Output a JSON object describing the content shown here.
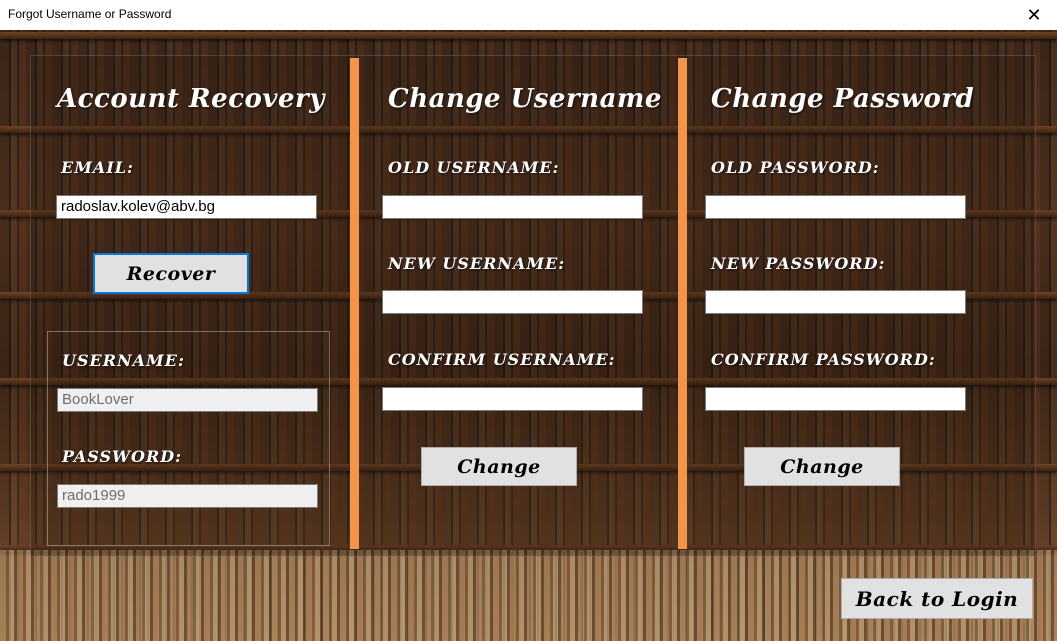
{
  "window": {
    "title": "Forgot Username or Password",
    "close_icon": "✕"
  },
  "recovery": {
    "heading": "Account Recovery",
    "email_label": "EMAIL:",
    "email_value": "radoslav.kolev@abv.bg",
    "recover_button": "Recover",
    "username_label": "USERNAME:",
    "username_value": "BookLover",
    "password_label": "PASSWORD:",
    "password_value": "rado1999"
  },
  "change_username": {
    "heading": "Change Username",
    "old_label": "OLD USERNAME:",
    "old_value": "",
    "new_label": "NEW USERNAME:",
    "new_value": "",
    "confirm_label": "CONFIRM USERNAME:",
    "confirm_value": "",
    "button": "Change"
  },
  "change_password": {
    "heading": "Change Password",
    "old_label": "OLD PASSWORD:",
    "old_value": "",
    "new_label": "NEW PASSWORD:",
    "new_value": "",
    "confirm_label": "CONFIRM PASSWORD:",
    "confirm_value": "",
    "button": "Change"
  },
  "footer": {
    "back_button": "Back to Login"
  },
  "colors": {
    "accent_divider": "#f2944a",
    "focus_border": "#0078d7"
  }
}
